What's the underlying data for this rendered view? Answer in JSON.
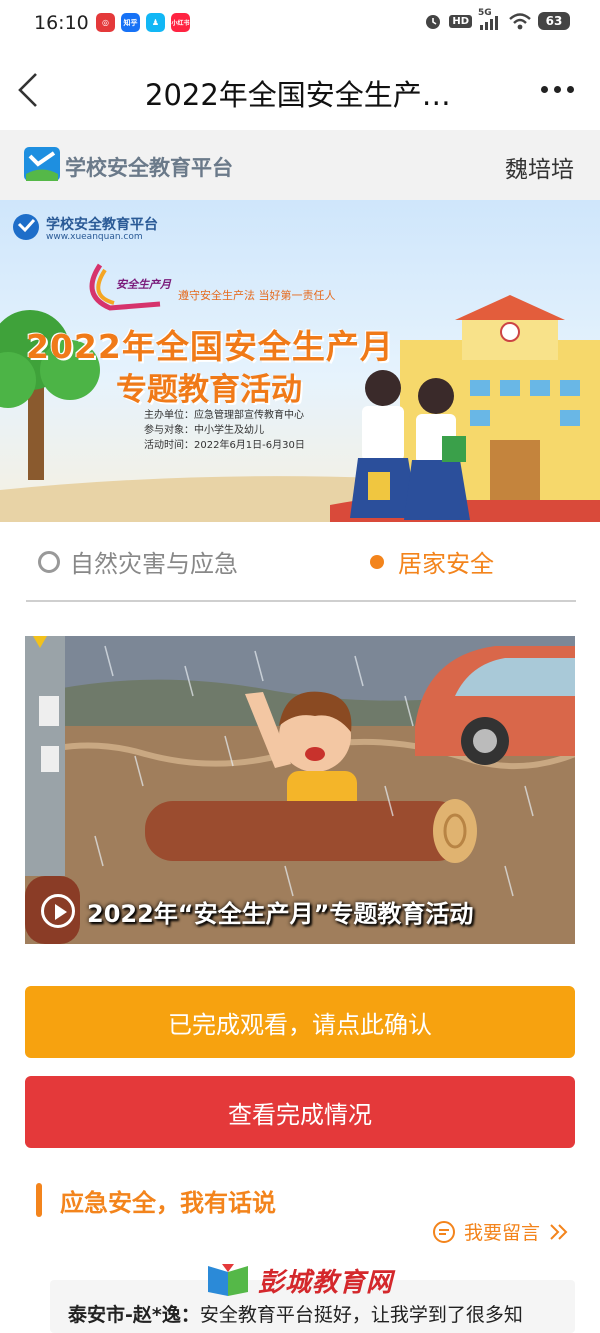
{
  "status_bar": {
    "time": "16:10",
    "notifications": [
      {
        "name": "netease-music-icon",
        "color": "#e4393a",
        "glyph": "◎"
      },
      {
        "name": "zhihu-icon",
        "color": "#1772f6",
        "glyph": "知乎"
      },
      {
        "name": "qq-icon",
        "color": "#12b7f5",
        "glyph": "♟"
      },
      {
        "name": "xiaohongshu-icon",
        "color": "#ff2442",
        "glyph": "小红书"
      }
    ],
    "hd_label": "HD",
    "network_label": "5G",
    "battery": "63"
  },
  "nav": {
    "title": "2022年全国安全生产…"
  },
  "platform": {
    "name": "学校安全教育平台",
    "user": "魏培培"
  },
  "banner": {
    "logo_text": "学校安全教育平台",
    "url": "www.xueanquan.com",
    "month_logo": "安全生产月",
    "slogan": "遵守安全生产法  当好第一责任人",
    "title_main": "2022年全国安全生产月",
    "title_sub": "专题教育活动",
    "info": [
      "主办单位：应急管理部宣传教育中心",
      "参与对象：中小学生及幼儿",
      "活动时间：2022年6月1日-6月30日"
    ]
  },
  "tabs": [
    {
      "label": "自然灾害与应急",
      "selected": false
    },
    {
      "label": "居家安全",
      "selected": true
    }
  ],
  "video": {
    "caption": "2022年“安全生产月”专题教育活动"
  },
  "buttons": {
    "confirm": "已完成观看，请点此确认",
    "status": "查看完成情况"
  },
  "comments_section": {
    "title": "应急安全，我有话说",
    "leave_message": "我要留言",
    "comments": [
      {
        "author": "泰安市-赵*逸：",
        "text": "安全教育平台挺好，让我学到了很多知"
      }
    ]
  },
  "watermark": {
    "text": "彭城教育网"
  },
  "colors": {
    "accent_orange": "#f3841c",
    "confirm_button": "#f7a20f",
    "status_button": "#e4393a"
  }
}
